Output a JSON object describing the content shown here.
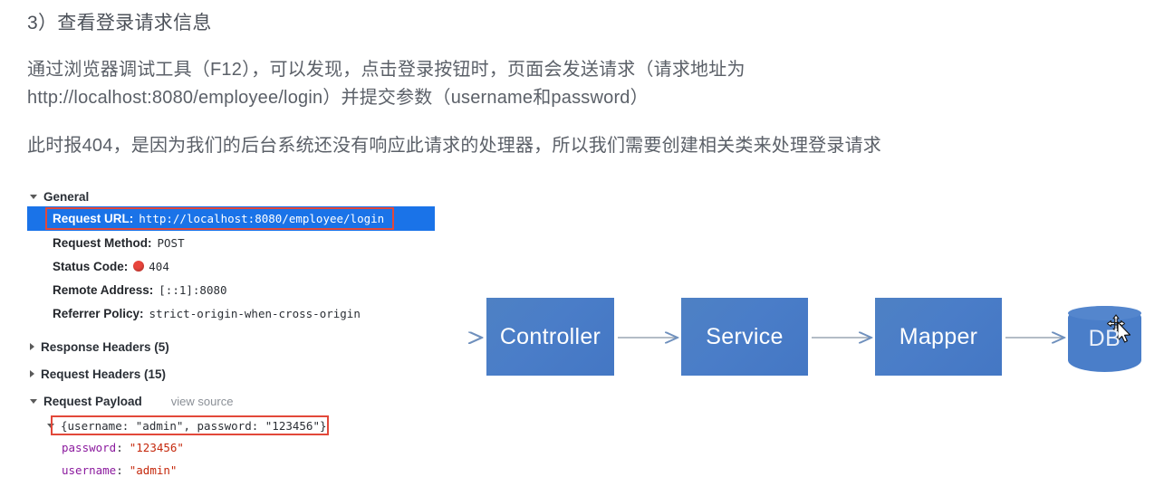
{
  "article": {
    "heading": "3）查看登录请求信息",
    "paragraph1_line1": "通过浏览器调试工具（F12），可以发现，点击登录按钮时，页面会发送请求（请求地址为",
    "paragraph1_line2": "http://localhost:8080/employee/login）并提交参数（username和password）",
    "paragraph2": "此时报404，是因为我们的后台系统还没有响应此请求的处理器，所以我们需要创建相关类来处理登录请求"
  },
  "devtools": {
    "general_section_label": "General",
    "rows": [
      {
        "key": "Request URL:",
        "value": "http://localhost:8080/employee/login"
      },
      {
        "key": "Request Method:",
        "value": "POST"
      },
      {
        "key": "Status Code:",
        "value": "404"
      },
      {
        "key": "Remote Address:",
        "value": "[::1]:8080"
      },
      {
        "key": "Referrer Policy:",
        "value": "strict-origin-when-cross-origin"
      }
    ],
    "response_headers_label": "Response Headers (5)",
    "request_headers_label": "Request Headers (15)",
    "request_payload_label": "Request Payload",
    "view_source_label": "view source",
    "payload_object": "{username: \"admin\", password: \"123456\"}",
    "payload_entries": [
      {
        "key": "password",
        "colon": ":",
        "value": "\"123456\""
      },
      {
        "key": "username",
        "colon": ":",
        "value": "\"admin\""
      }
    ],
    "highlight_color": "#1a73e8",
    "annotation_color": "#e2483a",
    "status_dot_color": "#e8453c"
  },
  "diagram": {
    "nodes": [
      {
        "label": "Controller"
      },
      {
        "label": "Service"
      },
      {
        "label": "Mapper"
      },
      {
        "label": "DB"
      }
    ],
    "node_color": "#4a7ec9",
    "arrow_color": "#7f9ec4"
  }
}
